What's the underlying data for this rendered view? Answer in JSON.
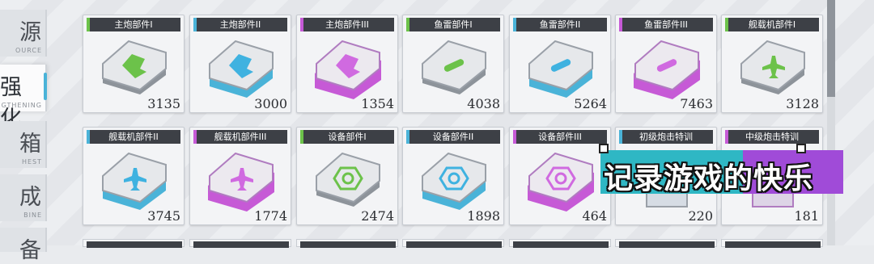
{
  "colors": {
    "tier1": "#6cc24a",
    "tier2": "#4ab3d8",
    "tier3": "#c65ad6",
    "bar": "#3d4046",
    "overlay_cyan": "#2fb7c4",
    "overlay_purple": "#a04bd8"
  },
  "sidebar": {
    "items": [
      {
        "cn": "源",
        "en": "OURCE",
        "active": false
      },
      {
        "cn": "强化",
        "en": "NGTHENING",
        "active": true
      },
      {
        "cn": "箱",
        "en": "HEST",
        "active": false
      },
      {
        "cn": "成",
        "en": "BINE",
        "active": false
      },
      {
        "cn": "备",
        "en": "",
        "active": false
      }
    ]
  },
  "inventory": {
    "row1": [
      {
        "name": "主炮部件I",
        "count": "3135",
        "tier": "1",
        "icon": "cannon-icon"
      },
      {
        "name": "主炮部件II",
        "count": "3000",
        "tier": "2",
        "icon": "cannon-icon"
      },
      {
        "name": "主炮部件III",
        "count": "1354",
        "tier": "3",
        "icon": "cannon-icon"
      },
      {
        "name": "鱼雷部件I",
        "count": "4038",
        "tier": "1",
        "icon": "torpedo-icon"
      },
      {
        "name": "鱼雷部件II",
        "count": "5264",
        "tier": "2",
        "icon": "torpedo-icon"
      },
      {
        "name": "鱼雷部件III",
        "count": "7463",
        "tier": "3",
        "icon": "torpedo-icon"
      },
      {
        "name": "舰载机部件I",
        "count": "3128",
        "tier": "1",
        "icon": "aircraft-icon"
      }
    ],
    "row2": [
      {
        "name": "舰载机部件II",
        "count": "3745",
        "tier": "2",
        "icon": "aircraft-icon"
      },
      {
        "name": "舰载机部件III",
        "count": "1774",
        "tier": "3",
        "icon": "aircraft-icon"
      },
      {
        "name": "设备部件I",
        "count": "2474",
        "tier": "1",
        "icon": "gear-icon"
      },
      {
        "name": "设备部件II",
        "count": "1898",
        "tier": "2",
        "icon": "gear-icon"
      },
      {
        "name": "设备部件III",
        "count": "464",
        "tier": "3",
        "icon": "gear-icon"
      },
      {
        "name": "初级炮击特训",
        "count": "220",
        "tier": "2",
        "icon": "book-icon"
      },
      {
        "name": "中级炮击特训",
        "count": "181",
        "tier": "3",
        "icon": "book-icon"
      }
    ]
  },
  "overlay": {
    "text": "记录游戏的快乐"
  }
}
